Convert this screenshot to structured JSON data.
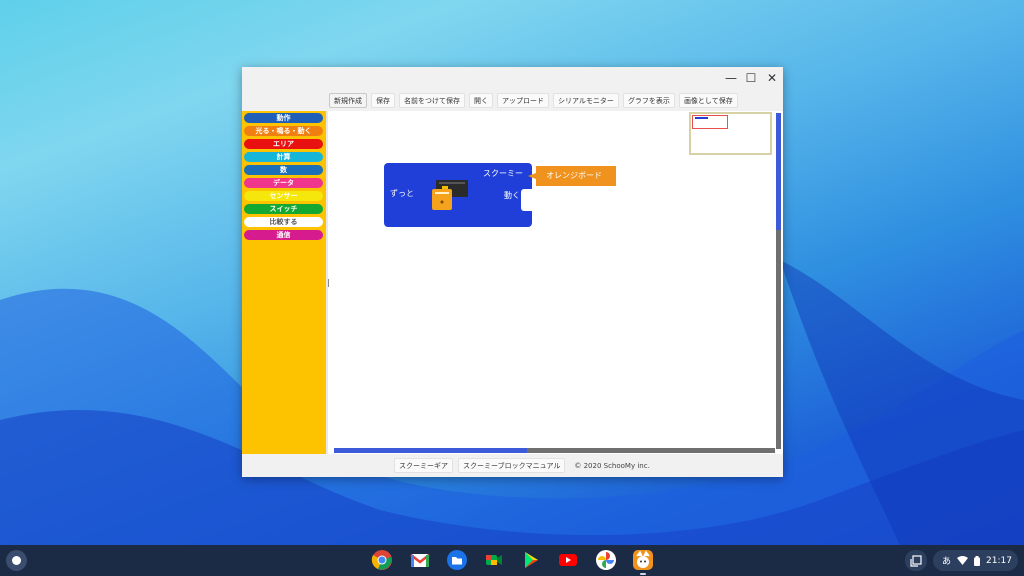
{
  "window": {
    "controls": {
      "minimize": "—",
      "maximize": "☐",
      "close": "✕"
    }
  },
  "toolbar": {
    "buttons": [
      "新規作成",
      "保存",
      "名前をつけて保存",
      "開く",
      "アップロード",
      "シリアルモニター",
      "グラフを表示",
      "画像として保存"
    ]
  },
  "palette": {
    "categories": [
      {
        "label": "動作",
        "color": "#1f5fb8"
      },
      {
        "label": "光る・鳴る・動く",
        "color": "#f07f12"
      },
      {
        "label": "エリア",
        "color": "#e81010"
      },
      {
        "label": "計算",
        "color": "#17b5d8"
      },
      {
        "label": "数",
        "color": "#1a6fb8"
      },
      {
        "label": "データ",
        "color": "#f0358c"
      },
      {
        "label": "センサー",
        "color": "#f5e60c"
      },
      {
        "label": "スイッチ",
        "color": "#12a832"
      },
      {
        "label": "比較する",
        "color": "#ffffff"
      },
      {
        "label": "通信",
        "color": "#d61b8e"
      }
    ]
  },
  "workspace": {
    "forever_block": {
      "label": "ずっと",
      "header": "スクーミー",
      "action": "動く"
    },
    "board_block": {
      "label": "オレンジボード"
    }
  },
  "footer": {
    "buttons": [
      "スクーミーギア",
      "スクーミーブロックマニュアル"
    ],
    "copyright": "© 2020 SchooMy inc."
  },
  "shelf": {
    "apps": [
      "chrome-icon",
      "gmail-icon",
      "files-icon",
      "meet-icon",
      "play-store-icon",
      "youtube-icon",
      "photos-icon",
      "schoomy-app-icon"
    ],
    "ime": "あ",
    "time": "21:17"
  }
}
